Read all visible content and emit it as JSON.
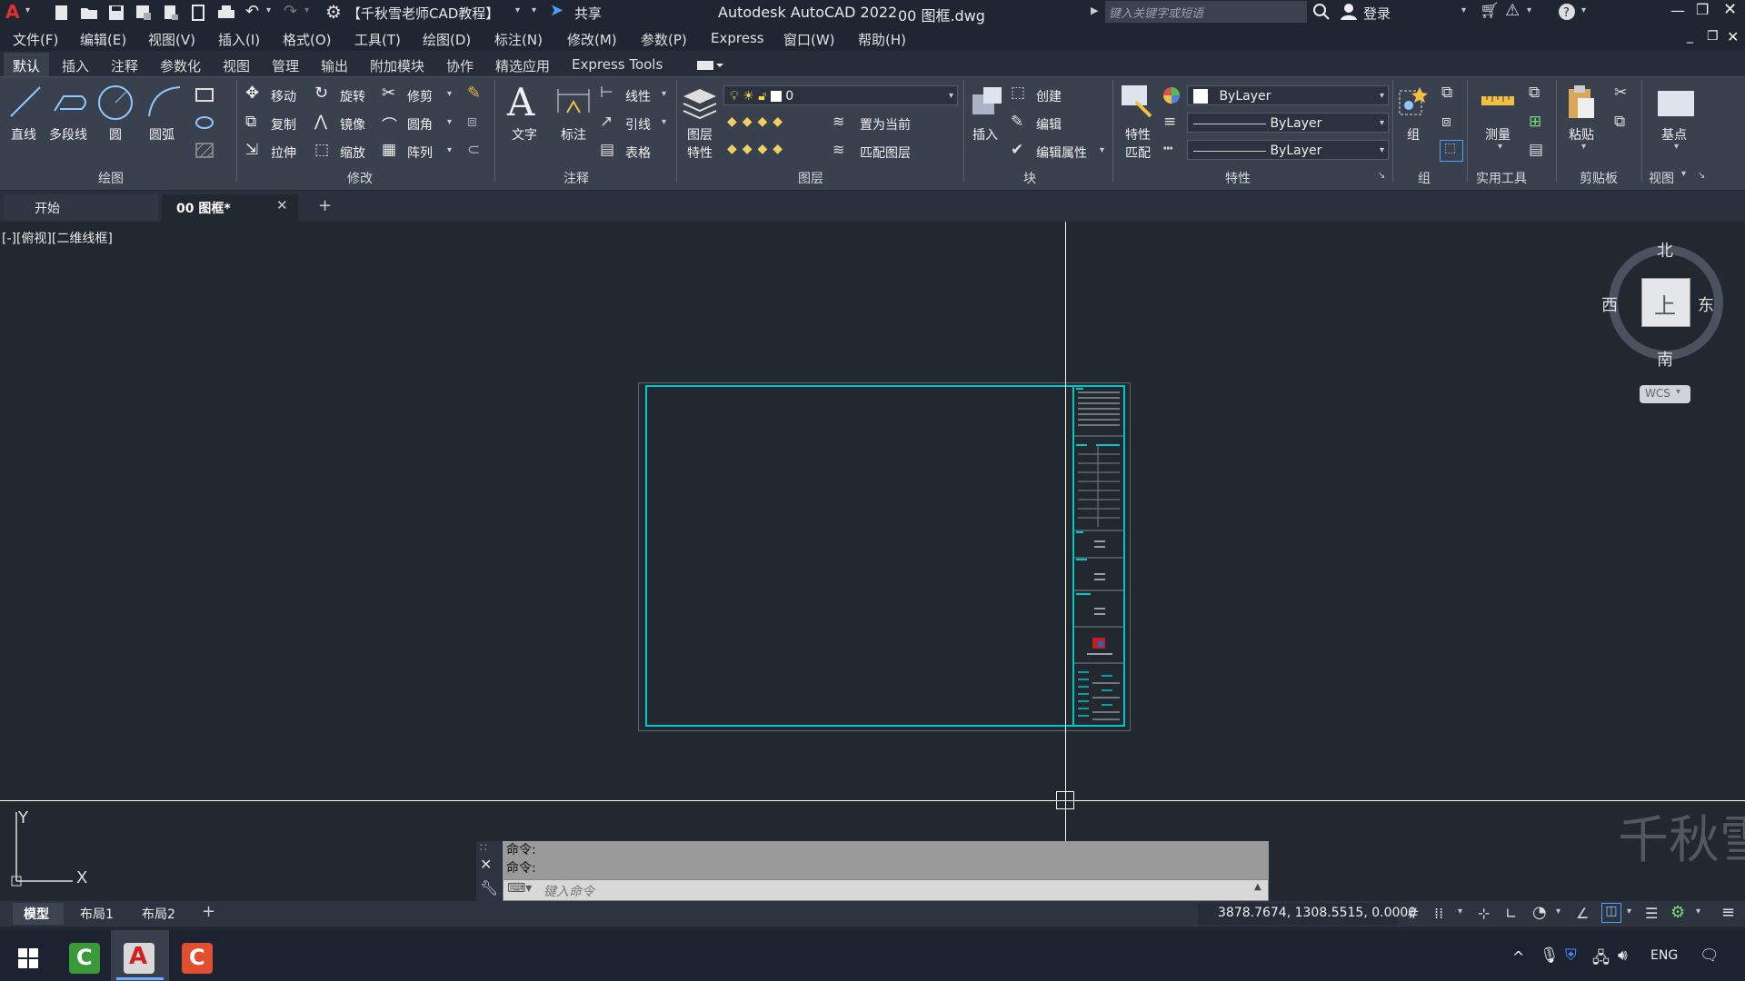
{
  "titlebar": {
    "workspace": "【千秋雪老师CAD教程】",
    "share": "共享",
    "app_title": "Autodesk AutoCAD 2022",
    "file_title": "00 图框.dwg",
    "search_placeholder": "键入关键字或短语",
    "signin": "登录"
  },
  "menubar": [
    "文件(F)",
    "编辑(E)",
    "视图(V)",
    "插入(I)",
    "格式(O)",
    "工具(T)",
    "绘图(D)",
    "标注(N)",
    "修改(M)",
    "参数(P)",
    "Express",
    "窗口(W)",
    "帮助(H)"
  ],
  "ribbon_tabs": [
    "默认",
    "插入",
    "注释",
    "参数化",
    "视图",
    "管理",
    "输出",
    "附加模块",
    "协作",
    "精选应用",
    "Express Tools"
  ],
  "ribbon": {
    "draw": {
      "line": "直线",
      "polyline": "多段线",
      "circle": "圆",
      "arc": "圆弧",
      "panel": "绘图"
    },
    "modify": {
      "move": "移动",
      "rotate": "旋转",
      "trim": "修剪",
      "copy": "复制",
      "mirror": "镜像",
      "fillet": "圆角",
      "stretch": "拉伸",
      "scale": "缩放",
      "array": "阵列",
      "panel": "修改"
    },
    "annotation": {
      "text": "文字",
      "dimension": "标注",
      "linear": "线性",
      "leader": "引线",
      "table": "表格",
      "panel": "注释"
    },
    "layers": {
      "layer_props": "图层",
      "layer_props2": "特性",
      "current_layer": "0",
      "make_current": "置为当前",
      "match_layer": "匹配图层",
      "panel": "图层"
    },
    "block": {
      "insert": "插入",
      "create": "创建",
      "edit": "编辑",
      "edit_attr": "编辑属性",
      "panel": "块"
    },
    "properties": {
      "match": "特性",
      "match2": "匹配",
      "color": "ByLayer",
      "linetype": "ByLayer",
      "lineweight": "ByLayer",
      "panel": "特性"
    },
    "groups": {
      "group": "组",
      "panel": "组"
    },
    "utilities": {
      "measure": "测量",
      "panel": "实用工具"
    },
    "clipboard": {
      "paste": "粘贴",
      "panel": "剪贴板"
    },
    "view": {
      "base": "基点",
      "panel": "视图"
    }
  },
  "doc_tabs": {
    "start": "开始",
    "active": "00 图框*"
  },
  "viewport_label": "[-][俯视][二维线框]",
  "viewcube": {
    "north": "北",
    "south": "南",
    "east": "东",
    "west": "西",
    "top": "上",
    "wcs": "WCS"
  },
  "ucs": {
    "x": "X",
    "y": "Y"
  },
  "command": {
    "history1": "命令:",
    "history2": "命令:",
    "placeholder": "键入命令"
  },
  "layout_tabs": [
    "模型",
    "布局1",
    "布局2"
  ],
  "status": {
    "coords": "3878.7674, 1308.5515, 0.0000"
  },
  "taskbar": {
    "lang": "ENG"
  },
  "watermark": "千秋雪",
  "colors": {
    "accent": "#00c8c8",
    "background": "#212830",
    "ribbon": "#39414f"
  }
}
